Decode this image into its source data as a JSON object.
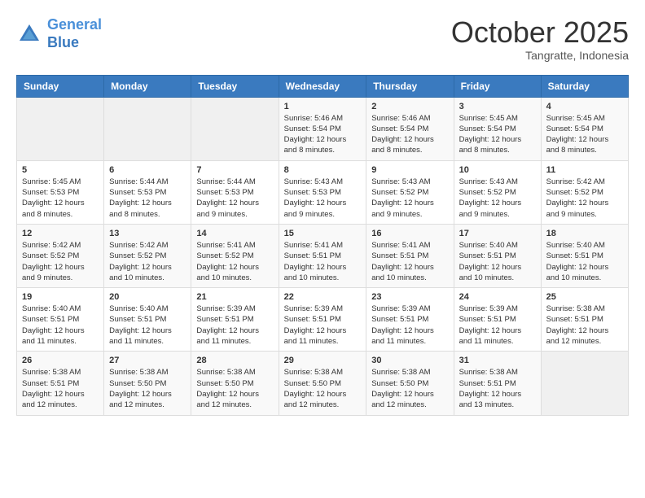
{
  "header": {
    "logo_line1": "General",
    "logo_line2": "Blue",
    "month": "October 2025",
    "location": "Tangratte, Indonesia"
  },
  "days_of_week": [
    "Sunday",
    "Monday",
    "Tuesday",
    "Wednesday",
    "Thursday",
    "Friday",
    "Saturday"
  ],
  "weeks": [
    [
      {
        "day": "",
        "sunrise": "",
        "sunset": "",
        "daylight": ""
      },
      {
        "day": "",
        "sunrise": "",
        "sunset": "",
        "daylight": ""
      },
      {
        "day": "",
        "sunrise": "",
        "sunset": "",
        "daylight": ""
      },
      {
        "day": "1",
        "sunrise": "Sunrise: 5:46 AM",
        "sunset": "Sunset: 5:54 PM",
        "daylight": "Daylight: 12 hours and 8 minutes."
      },
      {
        "day": "2",
        "sunrise": "Sunrise: 5:46 AM",
        "sunset": "Sunset: 5:54 PM",
        "daylight": "Daylight: 12 hours and 8 minutes."
      },
      {
        "day": "3",
        "sunrise": "Sunrise: 5:45 AM",
        "sunset": "Sunset: 5:54 PM",
        "daylight": "Daylight: 12 hours and 8 minutes."
      },
      {
        "day": "4",
        "sunrise": "Sunrise: 5:45 AM",
        "sunset": "Sunset: 5:54 PM",
        "daylight": "Daylight: 12 hours and 8 minutes."
      }
    ],
    [
      {
        "day": "5",
        "sunrise": "Sunrise: 5:45 AM",
        "sunset": "Sunset: 5:53 PM",
        "daylight": "Daylight: 12 hours and 8 minutes."
      },
      {
        "day": "6",
        "sunrise": "Sunrise: 5:44 AM",
        "sunset": "Sunset: 5:53 PM",
        "daylight": "Daylight: 12 hours and 8 minutes."
      },
      {
        "day": "7",
        "sunrise": "Sunrise: 5:44 AM",
        "sunset": "Sunset: 5:53 PM",
        "daylight": "Daylight: 12 hours and 9 minutes."
      },
      {
        "day": "8",
        "sunrise": "Sunrise: 5:43 AM",
        "sunset": "Sunset: 5:53 PM",
        "daylight": "Daylight: 12 hours and 9 minutes."
      },
      {
        "day": "9",
        "sunrise": "Sunrise: 5:43 AM",
        "sunset": "Sunset: 5:52 PM",
        "daylight": "Daylight: 12 hours and 9 minutes."
      },
      {
        "day": "10",
        "sunrise": "Sunrise: 5:43 AM",
        "sunset": "Sunset: 5:52 PM",
        "daylight": "Daylight: 12 hours and 9 minutes."
      },
      {
        "day": "11",
        "sunrise": "Sunrise: 5:42 AM",
        "sunset": "Sunset: 5:52 PM",
        "daylight": "Daylight: 12 hours and 9 minutes."
      }
    ],
    [
      {
        "day": "12",
        "sunrise": "Sunrise: 5:42 AM",
        "sunset": "Sunset: 5:52 PM",
        "daylight": "Daylight: 12 hours and 9 minutes."
      },
      {
        "day": "13",
        "sunrise": "Sunrise: 5:42 AM",
        "sunset": "Sunset: 5:52 PM",
        "daylight": "Daylight: 12 hours and 10 minutes."
      },
      {
        "day": "14",
        "sunrise": "Sunrise: 5:41 AM",
        "sunset": "Sunset: 5:52 PM",
        "daylight": "Daylight: 12 hours and 10 minutes."
      },
      {
        "day": "15",
        "sunrise": "Sunrise: 5:41 AM",
        "sunset": "Sunset: 5:51 PM",
        "daylight": "Daylight: 12 hours and 10 minutes."
      },
      {
        "day": "16",
        "sunrise": "Sunrise: 5:41 AM",
        "sunset": "Sunset: 5:51 PM",
        "daylight": "Daylight: 12 hours and 10 minutes."
      },
      {
        "day": "17",
        "sunrise": "Sunrise: 5:40 AM",
        "sunset": "Sunset: 5:51 PM",
        "daylight": "Daylight: 12 hours and 10 minutes."
      },
      {
        "day": "18",
        "sunrise": "Sunrise: 5:40 AM",
        "sunset": "Sunset: 5:51 PM",
        "daylight": "Daylight: 12 hours and 10 minutes."
      }
    ],
    [
      {
        "day": "19",
        "sunrise": "Sunrise: 5:40 AM",
        "sunset": "Sunset: 5:51 PM",
        "daylight": "Daylight: 12 hours and 11 minutes."
      },
      {
        "day": "20",
        "sunrise": "Sunrise: 5:40 AM",
        "sunset": "Sunset: 5:51 PM",
        "daylight": "Daylight: 12 hours and 11 minutes."
      },
      {
        "day": "21",
        "sunrise": "Sunrise: 5:39 AM",
        "sunset": "Sunset: 5:51 PM",
        "daylight": "Daylight: 12 hours and 11 minutes."
      },
      {
        "day": "22",
        "sunrise": "Sunrise: 5:39 AM",
        "sunset": "Sunset: 5:51 PM",
        "daylight": "Daylight: 12 hours and 11 minutes."
      },
      {
        "day": "23",
        "sunrise": "Sunrise: 5:39 AM",
        "sunset": "Sunset: 5:51 PM",
        "daylight": "Daylight: 12 hours and 11 minutes."
      },
      {
        "day": "24",
        "sunrise": "Sunrise: 5:39 AM",
        "sunset": "Sunset: 5:51 PM",
        "daylight": "Daylight: 12 hours and 11 minutes."
      },
      {
        "day": "25",
        "sunrise": "Sunrise: 5:38 AM",
        "sunset": "Sunset: 5:51 PM",
        "daylight": "Daylight: 12 hours and 12 minutes."
      }
    ],
    [
      {
        "day": "26",
        "sunrise": "Sunrise: 5:38 AM",
        "sunset": "Sunset: 5:51 PM",
        "daylight": "Daylight: 12 hours and 12 minutes."
      },
      {
        "day": "27",
        "sunrise": "Sunrise: 5:38 AM",
        "sunset": "Sunset: 5:50 PM",
        "daylight": "Daylight: 12 hours and 12 minutes."
      },
      {
        "day": "28",
        "sunrise": "Sunrise: 5:38 AM",
        "sunset": "Sunset: 5:50 PM",
        "daylight": "Daylight: 12 hours and 12 minutes."
      },
      {
        "day": "29",
        "sunrise": "Sunrise: 5:38 AM",
        "sunset": "Sunset: 5:50 PM",
        "daylight": "Daylight: 12 hours and 12 minutes."
      },
      {
        "day": "30",
        "sunrise": "Sunrise: 5:38 AM",
        "sunset": "Sunset: 5:50 PM",
        "daylight": "Daylight: 12 hours and 12 minutes."
      },
      {
        "day": "31",
        "sunrise": "Sunrise: 5:38 AM",
        "sunset": "Sunset: 5:51 PM",
        "daylight": "Daylight: 12 hours and 13 minutes."
      },
      {
        "day": "",
        "sunrise": "",
        "sunset": "",
        "daylight": ""
      }
    ]
  ]
}
